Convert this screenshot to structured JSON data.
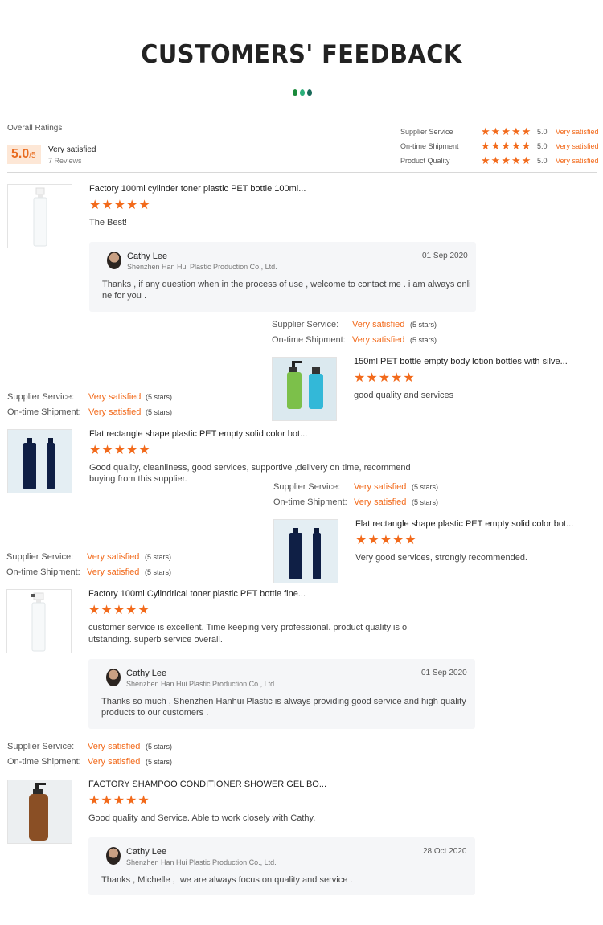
{
  "header": {
    "title": "CUSTOMERS' FEEDBACK",
    "drop_colors": [
      "#1a8a3a",
      "#2bb07a",
      "#1a6a5a"
    ]
  },
  "overall": {
    "label": "Overall Ratings",
    "score": "5.0",
    "score_den": "/5",
    "verdict": "Very satisfied",
    "reviews": "7 Reviews",
    "rows": [
      {
        "label": "Supplier Service",
        "score": "5.0",
        "verdict": "Very satisfied"
      },
      {
        "label": "On-time Shipment",
        "score": "5.0",
        "verdict": "Very satisfied"
      },
      {
        "label": "Product Quality",
        "score": "5.0",
        "verdict": "Very satisfied"
      }
    ]
  },
  "star_glyph": "★",
  "service_labels": {
    "supplier": "Supplier Service:",
    "shipment": "On-time Shipment:",
    "value": "Very satisfied",
    "stars": "(5 stars)"
  },
  "reviews": [
    {
      "product": "Factory 100ml cylinder toner plastic PET bottle 100ml...",
      "text": "The Best!",
      "reply": {
        "name": "Cathy Lee",
        "company": "Shenzhen Han Hui Plastic Production Co., Ltd.",
        "date": "01 Sep 2020",
        "text_lines": [
          "Thanks , if any question when in the process of use , welcome to contact me . i am always onli",
          "ne for you ."
        ]
      }
    },
    {
      "product": "150ml PET bottle empty body lotion bottles with silve...",
      "text": "good quality and services"
    },
    {
      "product": "Flat rectangle shape plastic PET empty solid color bot...",
      "text_lines": [
        "Good quality, cleanliness, good services, supportive ,delivery on time, recommend",
        "buying from this supplier."
      ]
    },
    {
      "product": "Flat rectangle shape plastic PET empty solid color bot...",
      "text": "Very good services, strongly recommended."
    },
    {
      "product": "Factory 100ml Cylindrical toner plastic PET bottle fine...",
      "text_lines": [
        "customer service is excellent. Time keeping very professional. product quality is o",
        "utstanding. superb service overall."
      ],
      "reply": {
        "name": "Cathy Lee",
        "company": "Shenzhen Han Hui Plastic Production Co., Ltd.",
        "date": "01 Sep 2020",
        "text_lines": [
          "Thanks so much , Shenzhen Hanhui Plastic is always providing good service and high quality",
          "products to our customers ."
        ]
      }
    },
    {
      "product": "FACTORY SHAMPOO CONDITIONER SHOWER GEL BO...",
      "text": "Good quality and Service. Able to work closely with Cathy.",
      "reply": {
        "name": "Cathy Lee",
        "company": "Shenzhen Han Hui Plastic Production Co., Ltd.",
        "date": "28 Oct 2020",
        "text": "Thanks , Michelle ,  we are always focus on quality and service ."
      }
    }
  ]
}
